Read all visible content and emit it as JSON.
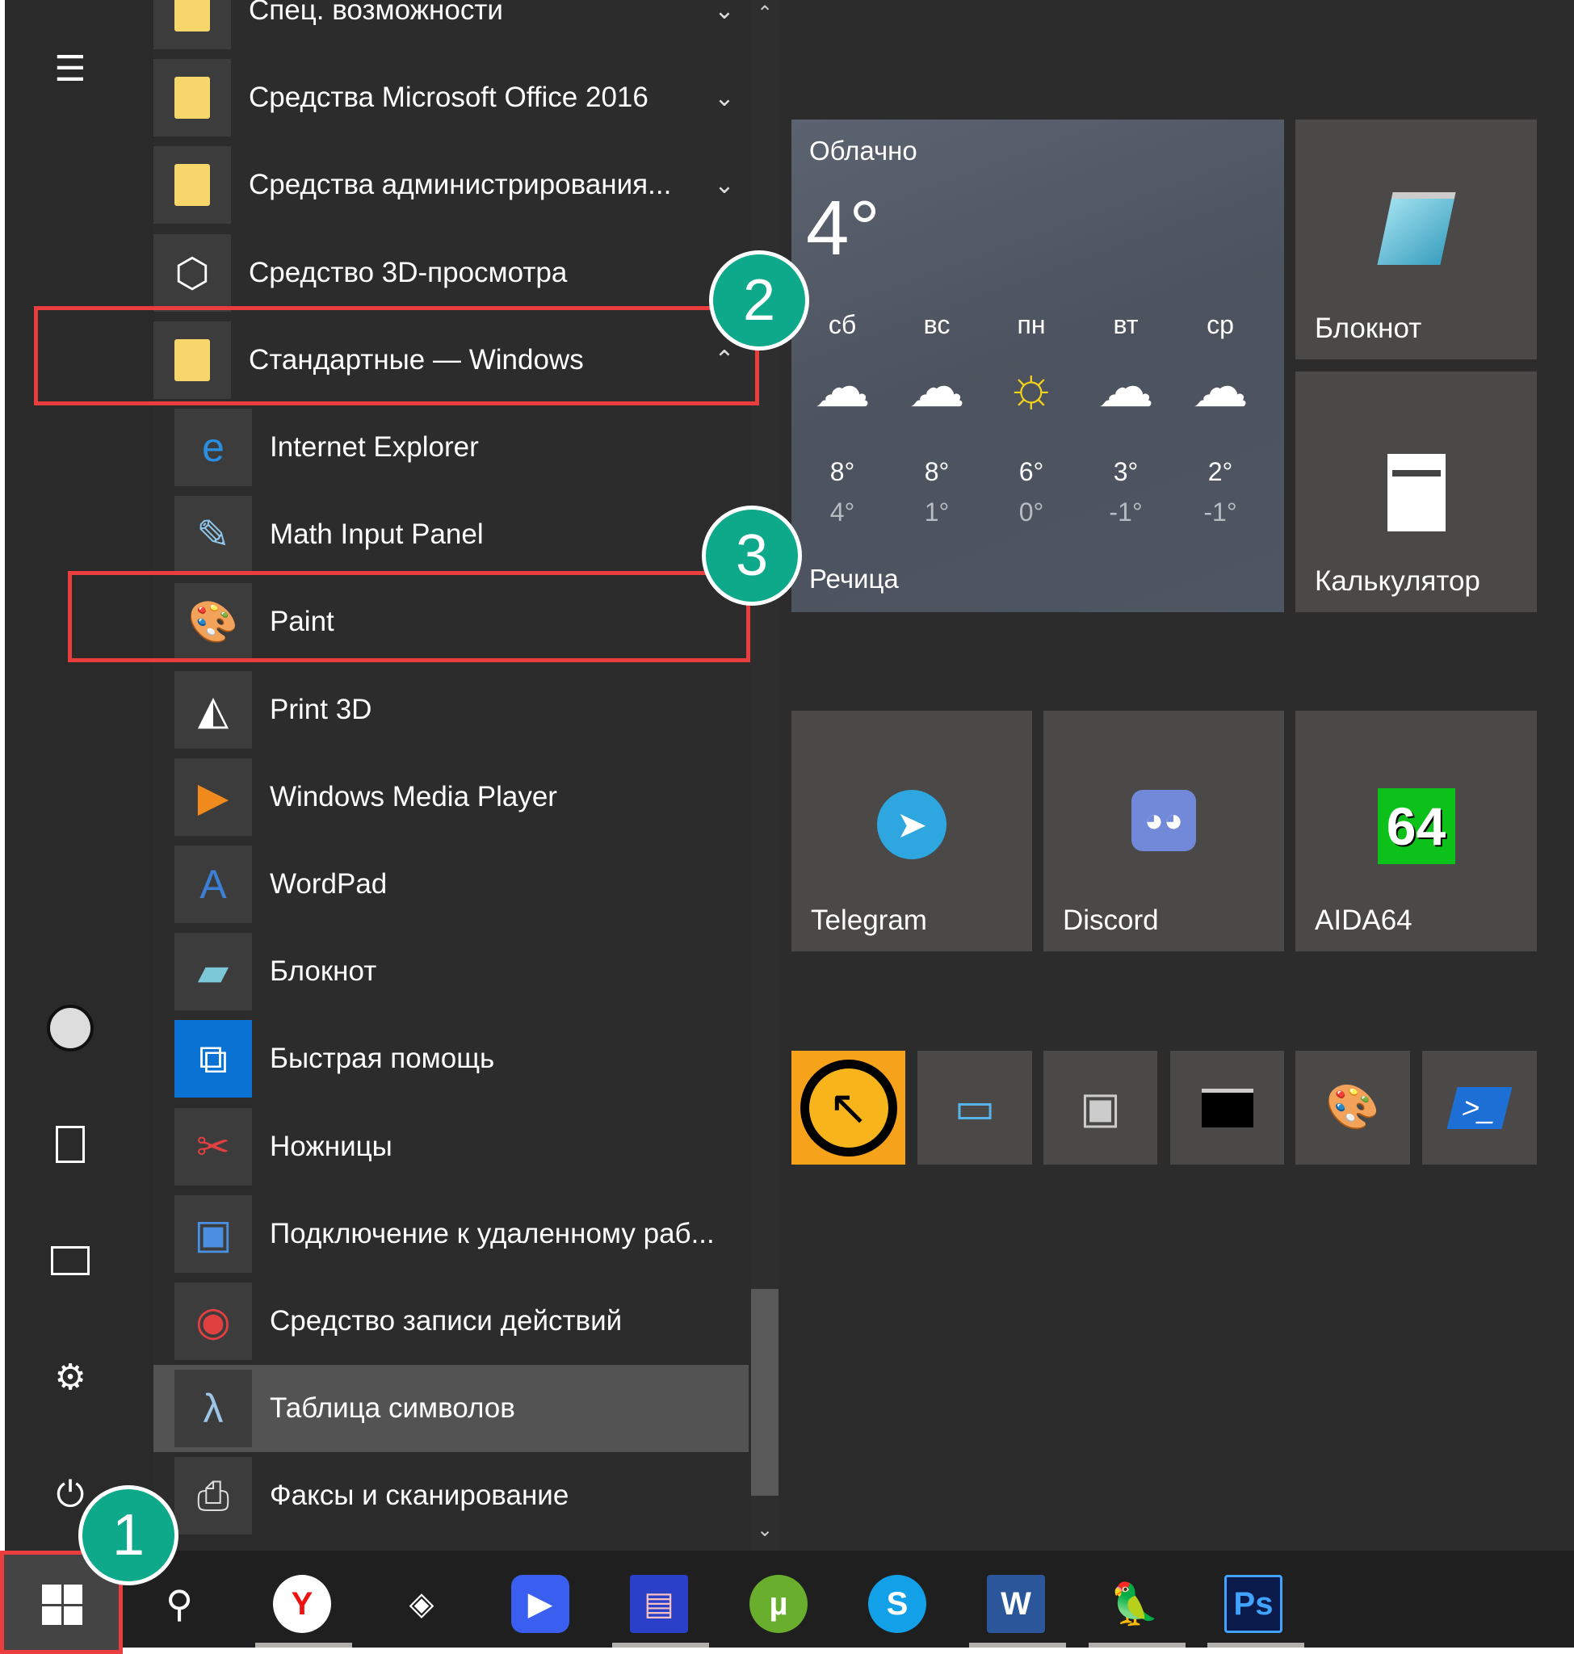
{
  "app_list": [
    {
      "label": "Спец. возможности",
      "icon": "folder-icon",
      "level": 0,
      "chevron": "⌄"
    },
    {
      "label": "Средства Microsoft Office 2016",
      "icon": "folder-icon",
      "level": 0,
      "chevron": "⌄"
    },
    {
      "label": "Средства администрирования...",
      "icon": "folder-icon",
      "level": 0,
      "chevron": "⌄"
    },
    {
      "label": "Средство 3D-просмотра",
      "icon": "cube-icon",
      "level": 0,
      "glyph": "⬡",
      "color": "#ffffff"
    },
    {
      "label": "Стандартные — Windows",
      "icon": "folder-icon",
      "level": 0,
      "chevron": "⌃"
    },
    {
      "label": "Internet Explorer",
      "icon": "internet-explorer-icon",
      "level": 1,
      "glyph": "e",
      "color": "#2a8fe0"
    },
    {
      "label": "Math Input Panel",
      "icon": "math-input-icon",
      "level": 1,
      "glyph": "✎",
      "color": "#8fc6ea"
    },
    {
      "label": "Paint",
      "icon": "paint-palette-icon",
      "level": 1,
      "glyph": "🎨",
      "color": "#e9a84c"
    },
    {
      "label": "Print 3D",
      "icon": "print-3d-icon",
      "level": 1,
      "glyph": "◭",
      "color": "#ffffff"
    },
    {
      "label": "Windows Media Player",
      "icon": "media-player-icon",
      "level": 1,
      "glyph": "▶",
      "color": "#f08a1c"
    },
    {
      "label": "WordPad",
      "icon": "wordpad-icon",
      "level": 1,
      "glyph": "A",
      "color": "#3b7fd6"
    },
    {
      "label": "Блокнот",
      "icon": "notepad-icon",
      "level": 1,
      "glyph": "▰",
      "color": "#7cc7d8"
    },
    {
      "label": "Быстрая помощь",
      "icon": "quick-assist-icon",
      "level": 1,
      "glyph": "⧉",
      "color": "#ffffff",
      "bg": "#0a72d2"
    },
    {
      "label": "Ножницы",
      "icon": "scissors-icon",
      "level": 1,
      "glyph": "✂",
      "color": "#e24040"
    },
    {
      "label": "Подключение к удаленному раб...",
      "icon": "remote-desktop-icon",
      "level": 1,
      "glyph": "▣",
      "color": "#4a8fe0"
    },
    {
      "label": "Средство записи действий",
      "icon": "steps-recorder-icon",
      "level": 1,
      "glyph": "◉",
      "color": "#e04040"
    },
    {
      "label": "Таблица символов",
      "icon": "character-map-icon",
      "level": 1,
      "glyph": "λ",
      "color": "#9ec4e8",
      "highlight": true
    },
    {
      "label": "Факсы и сканирование",
      "icon": "fax-scan-icon",
      "level": 1,
      "glyph": "⎙",
      "color": "#dddddd"
    }
  ],
  "weather": {
    "condition": "Облачно",
    "temp": "4°",
    "city": "Речица",
    "days": [
      {
        "day": "сб",
        "icon": "cloud-icon",
        "hi": "8°",
        "lo": "4°"
      },
      {
        "day": "вс",
        "icon": "cloud-icon",
        "hi": "8°",
        "lo": "1°"
      },
      {
        "day": "пн",
        "icon": "sun-icon",
        "hi": "6°",
        "lo": "0°"
      },
      {
        "day": "вт",
        "icon": "cloud-icon",
        "hi": "3°",
        "lo": "-1°"
      },
      {
        "day": "ср",
        "icon": "cloud-icon",
        "hi": "2°",
        "lo": "-1°"
      }
    ]
  },
  "tiles": {
    "notepad": "Блокнот",
    "calculator": "Калькулятор",
    "telegram": "Telegram",
    "discord": "Discord",
    "aida64": "AIDA64",
    "aida64_logo": "64"
  },
  "badges": {
    "one": "1",
    "two": "2",
    "three": "3"
  },
  "colors": {
    "accent_red": "#ea3e3e",
    "badge": "#0da98a",
    "tile": "#4a4948"
  }
}
